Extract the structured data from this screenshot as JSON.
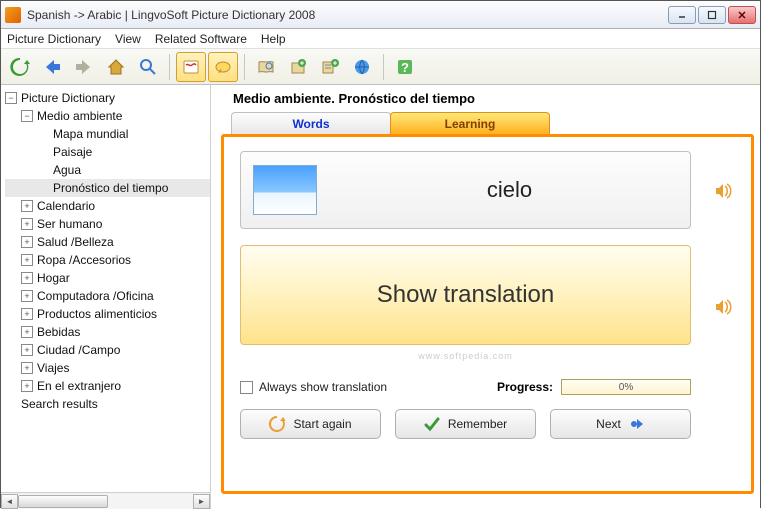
{
  "window": {
    "title": "Spanish -> Arabic | LingvoSoft Picture Dictionary 2008"
  },
  "menu": {
    "items": [
      "Picture Dictionary",
      "View",
      "Related Software",
      "Help"
    ]
  },
  "tree": {
    "root": "Picture Dictionary",
    "expanded": {
      "label": "Medio  ambiente",
      "children": [
        "Mapa  mundial",
        "Paisaje",
        "Agua",
        "Pronóstico  del tiempo"
      ]
    },
    "collapsed": [
      "Calendario",
      "Ser  humano",
      "Salud /Belleza",
      "Ropa /Accesorios",
      "Hogar",
      "Computadora /Oficina",
      "Productos  alimenticios",
      "Bebidas",
      "Ciudad /Campo",
      "Viajes",
      "En  el extranjero"
    ],
    "search": "Search results"
  },
  "main": {
    "heading": "Medio ambiente. Pronóstico del tiempo",
    "tabs": {
      "words": "Words",
      "learning": "Learning"
    },
    "current_word": "cielo",
    "show_translation": "Show translation",
    "watermark": "www.softpedia.com",
    "always_show": "Always show translation",
    "progress_label": "Progress:",
    "progress_value": "0%",
    "buttons": {
      "start": "Start again",
      "remember": "Remember",
      "next": "Next"
    }
  }
}
